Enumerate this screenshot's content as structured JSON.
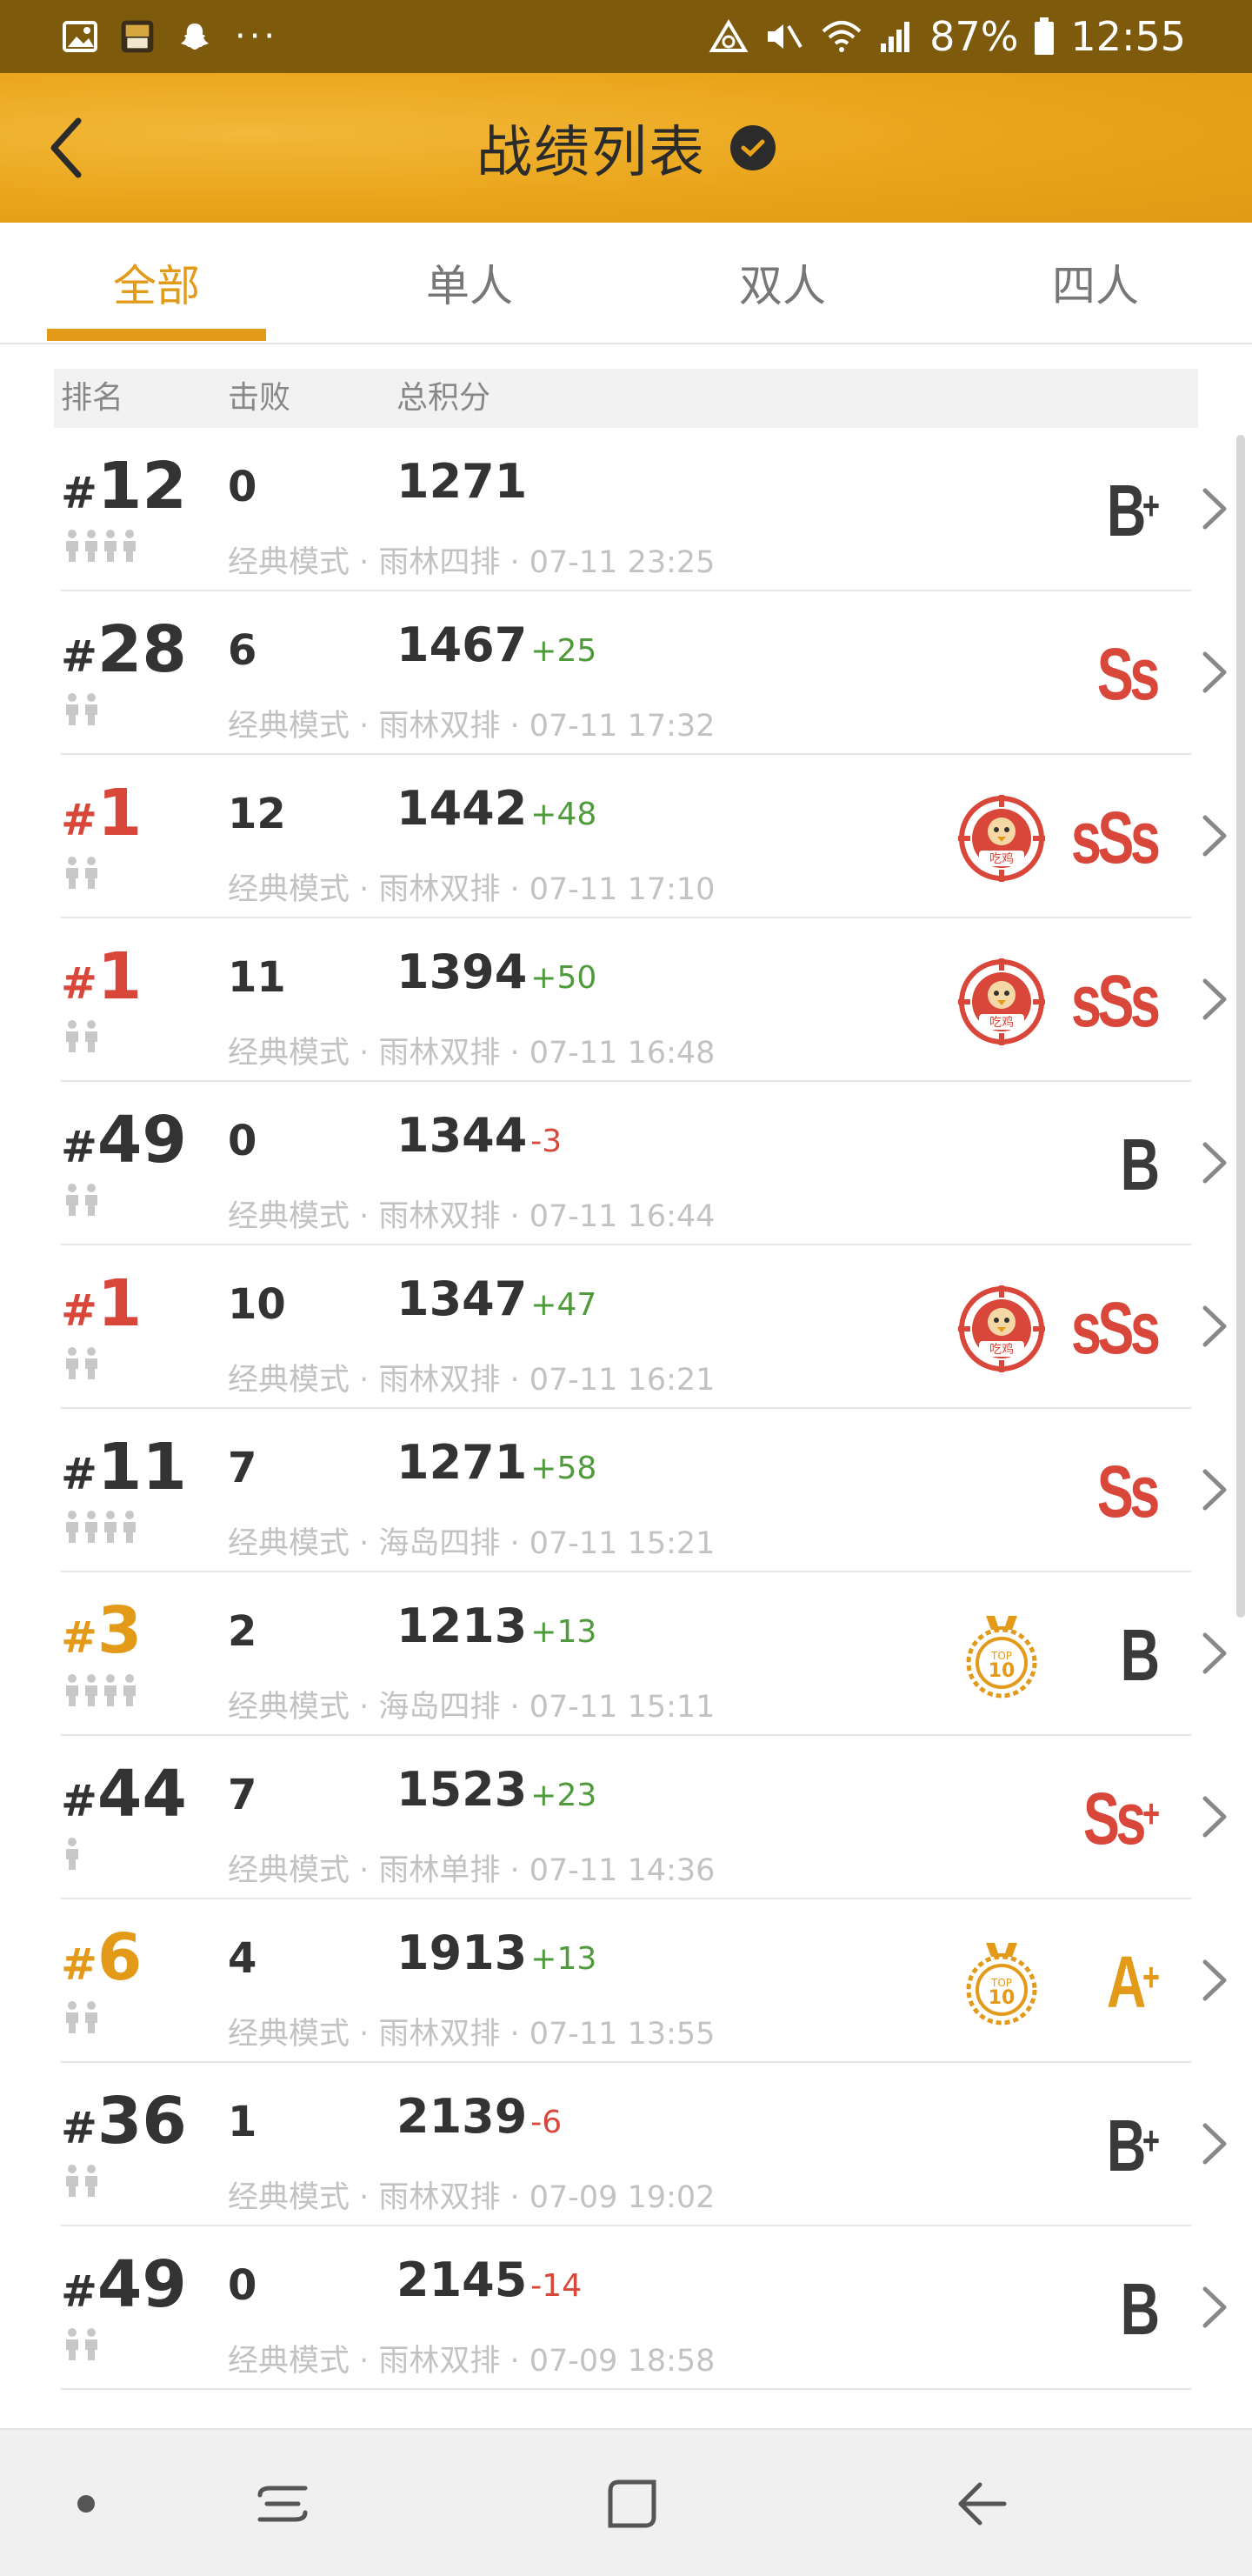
{
  "status_bar": {
    "battery": "87%",
    "time": "12:55",
    "more": "···"
  },
  "header": {
    "title": "战绩列表"
  },
  "tabs": [
    {
      "label": "全部",
      "active": true
    },
    {
      "label": "单人",
      "active": false
    },
    {
      "label": "双人",
      "active": false
    },
    {
      "label": "四人",
      "active": false
    }
  ],
  "columns": {
    "rank": "排名",
    "kills": "击败",
    "score": "总积分"
  },
  "matches": [
    {
      "rank": "12",
      "players": 4,
      "kills": "0",
      "score": "1271",
      "delta": "",
      "meta": "经典模式 · 雨林四排 · 07-11 23:25",
      "grade": "B",
      "grade_sup": "+",
      "badge": ""
    },
    {
      "rank": "28",
      "players": 2,
      "kills": "6",
      "score": "1467",
      "delta": "+25",
      "meta": "经典模式 · 雨林双排 · 07-11 17:32",
      "grade": "Ss",
      "grade_sup": "",
      "badge": ""
    },
    {
      "rank": "1",
      "players": 2,
      "kills": "12",
      "score": "1442",
      "delta": "+48",
      "meta": "经典模式 · 雨林双排 · 07-11 17:10",
      "grade": "sSs",
      "grade_sup": "",
      "badge": "吃鸡"
    },
    {
      "rank": "1",
      "players": 2,
      "kills": "11",
      "score": "1394",
      "delta": "+50",
      "meta": "经典模式 · 雨林双排 · 07-11 16:48",
      "grade": "sSs",
      "grade_sup": "",
      "badge": "吃鸡"
    },
    {
      "rank": "49",
      "players": 2,
      "kills": "0",
      "score": "1344",
      "delta": "-3",
      "meta": "经典模式 · 雨林双排 · 07-11 16:44",
      "grade": "B",
      "grade_sup": "",
      "badge": ""
    },
    {
      "rank": "1",
      "players": 2,
      "kills": "10",
      "score": "1347",
      "delta": "+47",
      "meta": "经典模式 · 雨林双排 · 07-11 16:21",
      "grade": "sSs",
      "grade_sup": "",
      "badge": "吃鸡"
    },
    {
      "rank": "11",
      "players": 4,
      "kills": "7",
      "score": "1271",
      "delta": "+58",
      "meta": "经典模式 · 海岛四排 · 07-11 15:21",
      "grade": "Ss",
      "grade_sup": "",
      "badge": ""
    },
    {
      "rank": "3",
      "players": 4,
      "kills": "2",
      "score": "1213",
      "delta": "+13",
      "meta": "经典模式 · 海岛四排 · 07-11 15:11",
      "grade": "B",
      "grade_sup": "",
      "badge": "TOP 10"
    },
    {
      "rank": "44",
      "players": 1,
      "kills": "7",
      "score": "1523",
      "delta": "+23",
      "meta": "经典模式 · 雨林单排 · 07-11 14:36",
      "grade": "Ss",
      "grade_sup": "+",
      "badge": ""
    },
    {
      "rank": "6",
      "players": 2,
      "kills": "4",
      "score": "1913",
      "delta": "+13",
      "meta": "经典模式 · 雨林双排 · 07-11 13:55",
      "grade": "A",
      "grade_sup": "+",
      "badge": "TOP 10"
    },
    {
      "rank": "36",
      "players": 2,
      "kills": "1",
      "score": "2139",
      "delta": "-6",
      "meta": "经典模式 · 雨林双排 · 07-09 19:02",
      "grade": "B",
      "grade_sup": "+",
      "badge": ""
    },
    {
      "rank": "49",
      "players": 2,
      "kills": "0",
      "score": "2145",
      "delta": "-14",
      "meta": "经典模式 · 雨林双排 · 07-09 18:58",
      "grade": "B",
      "grade_sup": "",
      "badge": ""
    }
  ],
  "colors": {
    "accent": "#e39a18",
    "status_bar": "#7d5a0c",
    "win_red": "#d9473b",
    "gain_green": "#4f9a3a"
  }
}
